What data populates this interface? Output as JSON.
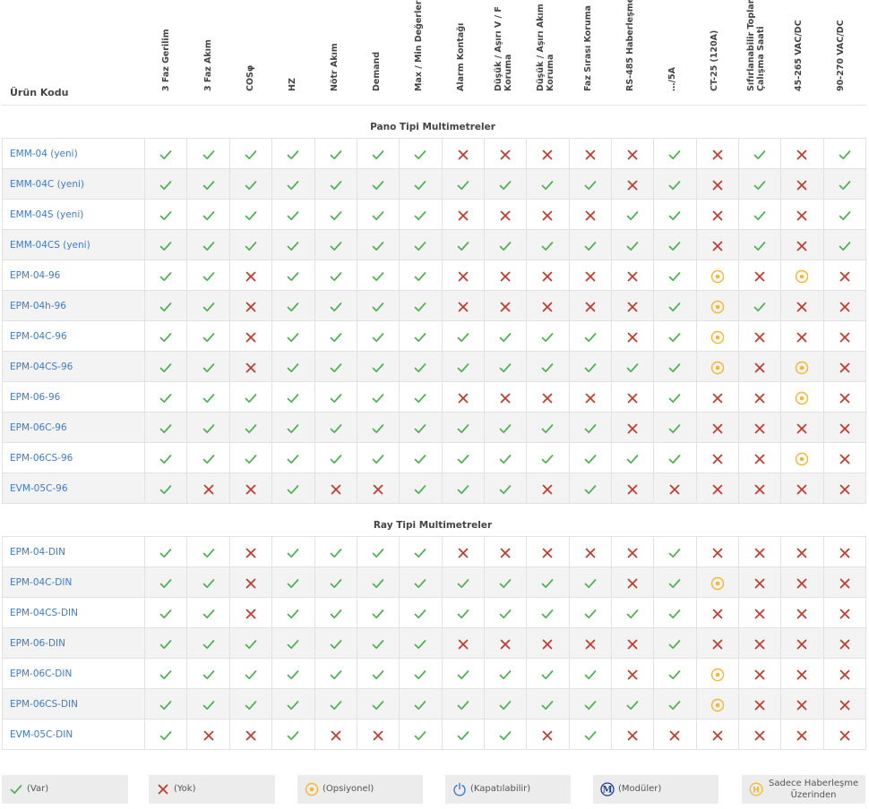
{
  "header": {
    "code_label": "Ürün Kodu",
    "columns": [
      "3 Faz Gerilim",
      "3 Faz Akım",
      "COSφ",
      "HZ",
      "Nötr Akım",
      "Demand",
      "Max / Min Değerler",
      "Alarm Kontağı",
      "Düşük / Aşırı V / F\nKoruma",
      "Düşük / Aşırı Akım\nKoruma",
      "Faz Sırası Koruma",
      "RS-485 Haberleşme",
      "…/5A",
      "CT-25 (120A)",
      "Sıfırlanabilir Toplam\nÇalışma Saati",
      "45-265 VAC/DC",
      "90-270 VAC/DC"
    ]
  },
  "sections": [
    {
      "title": "Pano Tipi Multimetreler",
      "rows": [
        {
          "code": "EMM-04 (yeni)",
          "v": "VVVVVVVXXXXXVXVXV"
        },
        {
          "code": "EMM-04C (yeni)",
          "v": "VVVVVVVVVVVXVXVXV"
        },
        {
          "code": "EMM-04S (yeni)",
          "v": "VVVVVVVXXXXVVXVXV"
        },
        {
          "code": "EMM-04CS (yeni)",
          "v": "VVVVVVVVVVVVVXVXV"
        },
        {
          "code": "EPM-04-96",
          "v": "VVXVVVVXXXXXVOXOX"
        },
        {
          "code": "EPM-04h-96",
          "v": "VVXVVVVXXXXXVOVXX"
        },
        {
          "code": "EPM-04C-96",
          "v": "VVXVVVVVVVVXVOXXX"
        },
        {
          "code": "EPM-04CS-96",
          "v": "VVXVVVVVVVVVVOXOX"
        },
        {
          "code": "EPM-06-96",
          "v": "VVVVVVVXXXXXVXXOX"
        },
        {
          "code": "EPM-06C-96",
          "v": "VVVVVVVVVVVXVXXXX"
        },
        {
          "code": "EPM-06CS-96",
          "v": "VVVVVVVVVVVVVXXOX"
        },
        {
          "code": "EVM-05C-96",
          "v": "VXXVXXVVVXVXXXXXX"
        }
      ]
    },
    {
      "title": "Ray Tipi Multimetreler",
      "rows": [
        {
          "code": "EPM-04-DIN",
          "v": "VVXVVVVXXXXXVXXXX"
        },
        {
          "code": "EPM-04C-DIN",
          "v": "VVXVVVVVVVVXVOXXX"
        },
        {
          "code": "EPM-04CS-DIN",
          "v": "VVXVVVVVVVVVVXXXX"
        },
        {
          "code": "EPM-06-DIN",
          "v": "VVVVVVVXXXXXVXXXX"
        },
        {
          "code": "EPM-06C-DIN",
          "v": "VVVVVVVVVVVXVOXXX"
        },
        {
          "code": "EPM-06CS-DIN",
          "v": "VVVVVVVVVVVVVOXXX"
        },
        {
          "code": "EVM-05C-DIN",
          "v": "VXXVXXVVVXVXXXXXX"
        }
      ]
    }
  ],
  "legend": [
    {
      "icon": "check-icon",
      "label": "(Var)"
    },
    {
      "icon": "cross-icon",
      "label": "(Yok)"
    },
    {
      "icon": "optional-icon",
      "label": "(Opsiyonel)"
    },
    {
      "icon": "power-icon",
      "label": "(Kapatılabilir)"
    },
    {
      "icon": "modular-icon",
      "label": "(Modüler)"
    },
    {
      "icon": "h-icon",
      "label": "Sadece Haberleşme\nÜzerinden"
    }
  ],
  "colors": {
    "check": "#4caf50",
    "cross": "#c0392b",
    "optional": "#f5b731",
    "power": "#3f7ac9",
    "modular": "#1c3f94",
    "link": "#3f7ac9"
  }
}
